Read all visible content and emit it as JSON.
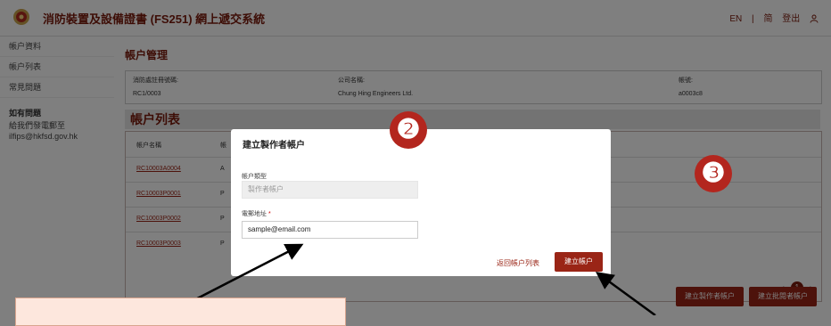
{
  "header": {
    "title": "消防裝置及設備證書 (FS251) 網上遞交系統",
    "lang_en": "EN",
    "separator": "|",
    "lang_zh": "简",
    "logout": "登出",
    "user_icon": "user-icon"
  },
  "sidebar": {
    "items": [
      {
        "label": "帳户資料"
      },
      {
        "label": "帳户列表"
      },
      {
        "label": "常見問題"
      }
    ],
    "help_title": "如有問題",
    "help_line1": "給我們發電郵至",
    "help_email": "ilfips@hkfsd.gov.hk"
  },
  "main": {
    "account_mgmt_title": "帳户管理",
    "info": {
      "reg_label": "消防處註冊號碼:",
      "reg_value": "RC1/0003",
      "company_label": "公司名稱:",
      "company_value": "Chung Hing Engineers Ltd.",
      "account_label": "帳號:",
      "account_value": "a0003c8"
    },
    "list_title": "帳户列表",
    "columns": {
      "name": "帳户名稱",
      "type": "帳"
    },
    "rows": [
      {
        "id": "RC10003A0004",
        "type": "A"
      },
      {
        "id": "RC10003P0001",
        "type": "P"
      },
      {
        "id": "RC10003P0002",
        "type": "P"
      },
      {
        "id": "RC10003P0003",
        "type": "P"
      }
    ],
    "pager": {
      "prev": "‹",
      "current": "1",
      "next": "›"
    },
    "buttons": {
      "create_maker": "建立製作者帳户",
      "create_approver": "建立批閱者帳户"
    }
  },
  "modal": {
    "title": "建立製作者帳户",
    "type_label": "帳户類型",
    "type_value": "製作者帳户",
    "email_label": "電郵地址",
    "required_mark": "*",
    "email_value": "sample@email.com",
    "back_link": "返回帳户列表",
    "create_button": "建立帳户"
  },
  "annotations": {
    "badge2": "❷",
    "badge3": "❸",
    "badge_color": "#b3261e",
    "note_text": ""
  }
}
